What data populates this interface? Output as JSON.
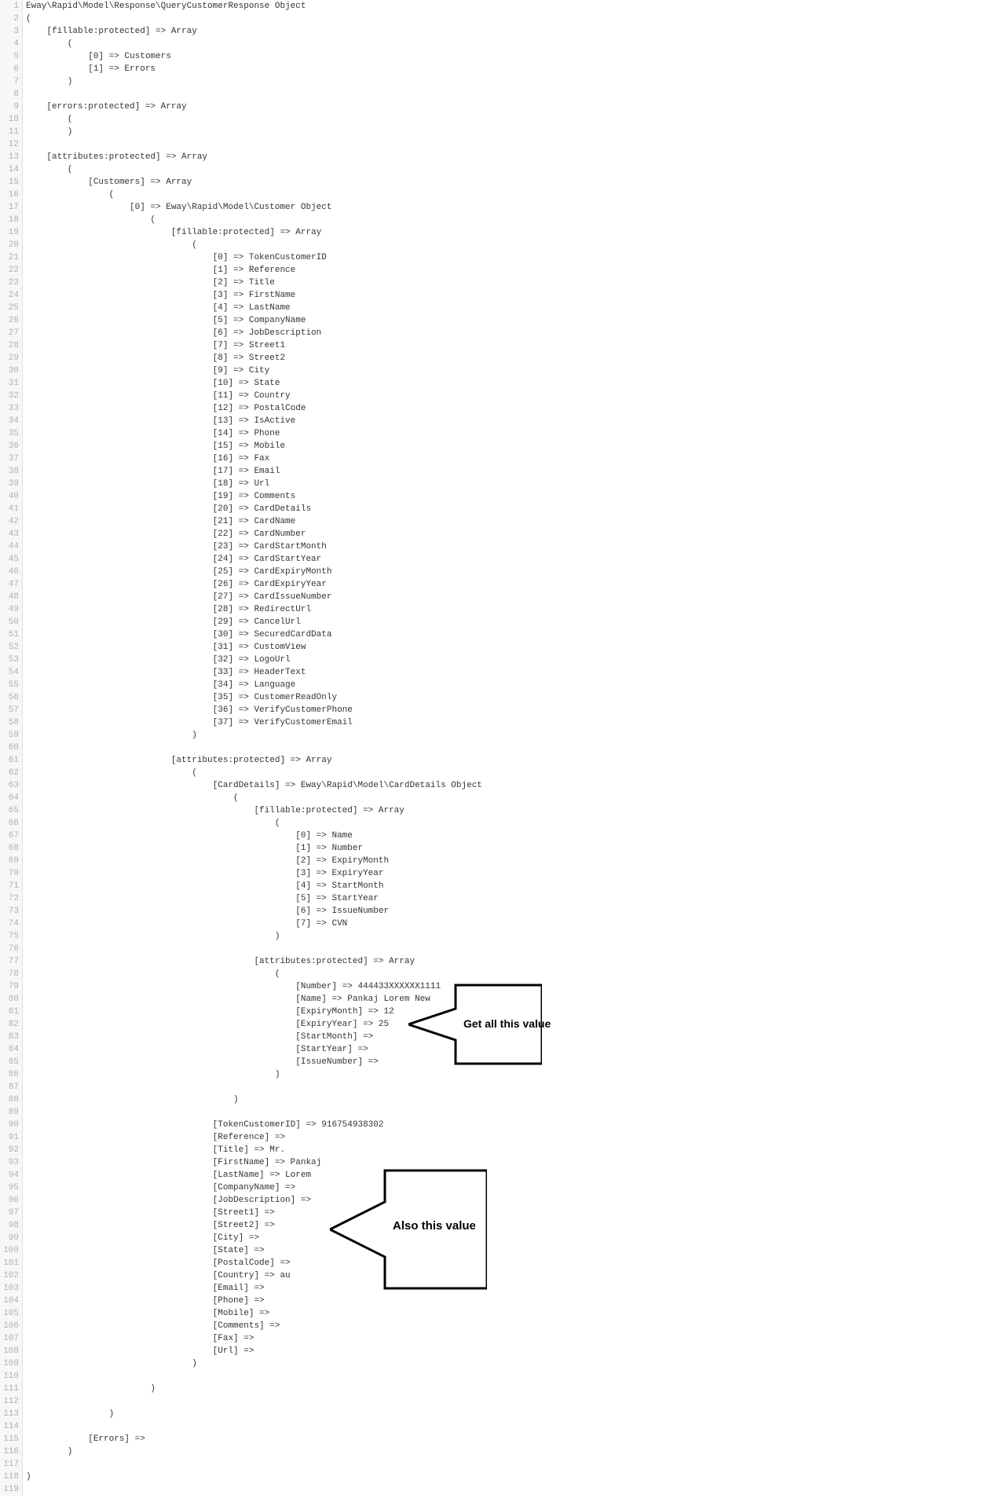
{
  "lines": [
    "Eway\\Rapid\\Model\\Response\\QueryCustomerResponse Object",
    "(",
    "    [fillable:protected] => Array",
    "        (",
    "            [0] => Customers",
    "            [1] => Errors",
    "        )",
    "",
    "    [errors:protected] => Array",
    "        (",
    "        )",
    "",
    "    [attributes:protected] => Array",
    "        (",
    "            [Customers] => Array",
    "                (",
    "                    [0] => Eway\\Rapid\\Model\\Customer Object",
    "                        (",
    "                            [fillable:protected] => Array",
    "                                (",
    "                                    [0] => TokenCustomerID",
    "                                    [1] => Reference",
    "                                    [2] => Title",
    "                                    [3] => FirstName",
    "                                    [4] => LastName",
    "                                    [5] => CompanyName",
    "                                    [6] => JobDescription",
    "                                    [7] => Street1",
    "                                    [8] => Street2",
    "                                    [9] => City",
    "                                    [10] => State",
    "                                    [11] => Country",
    "                                    [12] => PostalCode",
    "                                    [13] => IsActive",
    "                                    [14] => Phone",
    "                                    [15] => Mobile",
    "                                    [16] => Fax",
    "                                    [17] => Email",
    "                                    [18] => Url",
    "                                    [19] => Comments",
    "                                    [20] => CardDetails",
    "                                    [21] => CardName",
    "                                    [22] => CardNumber",
    "                                    [23] => CardStartMonth",
    "                                    [24] => CardStartYear",
    "                                    [25] => CardExpiryMonth",
    "                                    [26] => CardExpiryYear",
    "                                    [27] => CardIssueNumber",
    "                                    [28] => RedirectUrl",
    "                                    [29] => CancelUrl",
    "                                    [30] => SecuredCardData",
    "                                    [31] => CustomView",
    "                                    [32] => LogoUrl",
    "                                    [33] => HeaderText",
    "                                    [34] => Language",
    "                                    [35] => CustomerReadOnly",
    "                                    [36] => VerifyCustomerPhone",
    "                                    [37] => VerifyCustomerEmail",
    "                                )",
    "",
    "                            [attributes:protected] => Array",
    "                                (",
    "                                    [CardDetails] => Eway\\Rapid\\Model\\CardDetails Object",
    "                                        (",
    "                                            [fillable:protected] => Array",
    "                                                (",
    "                                                    [0] => Name",
    "                                                    [1] => Number",
    "                                                    [2] => ExpiryMonth",
    "                                                    [3] => ExpiryYear",
    "                                                    [4] => StartMonth",
    "                                                    [5] => StartYear",
    "                                                    [6] => IssueNumber",
    "                                                    [7] => CVN",
    "                                                )",
    "",
    "                                            [attributes:protected] => Array",
    "                                                (",
    "                                                    [Number] => 444433XXXXXX1111",
    "                                                    [Name] => Pankaj Lorem New",
    "                                                    [ExpiryMonth] => 12",
    "                                                    [ExpiryYear] => 25",
    "                                                    [StartMonth] => ",
    "                                                    [StartYear] => ",
    "                                                    [IssueNumber] => ",
    "                                                )",
    "",
    "                                        )",
    "",
    "                                    [TokenCustomerID] => 916754938302",
    "                                    [Reference] => ",
    "                                    [Title] => Mr.",
    "                                    [FirstName] => Pankaj",
    "                                    [LastName] => Lorem",
    "                                    [CompanyName] => ",
    "                                    [JobDescription] => ",
    "                                    [Street1] => ",
    "                                    [Street2] => ",
    "                                    [City] => ",
    "                                    [State] => ",
    "                                    [PostalCode] => ",
    "                                    [Country] => au",
    "                                    [Email] => ",
    "                                    [Phone] => ",
    "                                    [Mobile] => ",
    "                                    [Comments] => ",
    "                                    [Fax] => ",
    "                                    [Url] => ",
    "                                )",
    "",
    "                        )",
    "",
    "                )",
    "",
    "            [Errors] => ",
    "        )",
    "",
    ")",
    ""
  ],
  "annotations": {
    "arrow1_label": "Get all this value",
    "arrow2_label": "Also this value"
  }
}
